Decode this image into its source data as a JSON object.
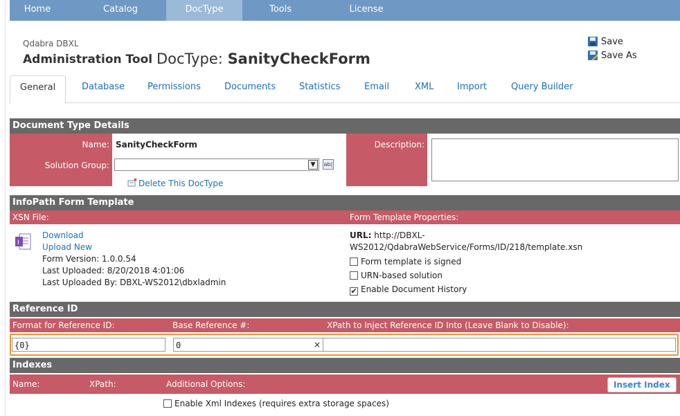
{
  "nav": [
    "Home",
    "Catalog",
    "DocType",
    "Tools",
    "License"
  ],
  "header": {
    "product": "Qdabra DBXL",
    "app_title": "Administration Tool",
    "doctype_prefix": "DocType:",
    "doctype_name": "SanityCheckForm",
    "save": "Save",
    "save_as": "Save As"
  },
  "tabs": [
    "General",
    "Database",
    "Permissions",
    "Documents",
    "Statistics",
    "Email",
    "XML",
    "Import",
    "Query Builder"
  ],
  "details": {
    "section_title": "Document Type Details",
    "name_label": "Name:",
    "name_value": "SanityCheckForm",
    "solution_group_label": "Solution Group:",
    "solution_group_value": "",
    "delete_label": "Delete This DocType",
    "description_label": "Description:",
    "description_value": ""
  },
  "infopath": {
    "section_title": "InfoPath Form Template",
    "xsn_label": "XSN File:",
    "props_label": "Form Template Properties:",
    "download": "Download",
    "upload": "Upload New",
    "version": "Form Version: 1.0.0.54",
    "last_uploaded": "Last Uploaded: 8/20/2018 4:01:06",
    "last_uploaded_by": "Last Uploaded By: DBXL-WS2012\\dbxladmin",
    "url_label": "URL:",
    "url_line1": "http://DBXL-",
    "url_line2": "WS2012/QdabraWebService/Forms/ID/218/template.xsn",
    "signed": "Form template is signed",
    "urn": "URN-based solution",
    "history": "Enable Document History",
    "signed_checked": false,
    "urn_checked": false,
    "history_checked": true
  },
  "reference": {
    "section_title": "Reference ID",
    "format_label": "Format for Reference ID:",
    "base_label": "Base Reference #:",
    "xpath_label": "XPath to Inject Reference ID Into (Leave Blank to Disable):",
    "format_value": "{0}",
    "base_value": "0",
    "xpath_value": "",
    "clear_glyph": "×"
  },
  "indexes": {
    "section_title": "Indexes",
    "name_col": "Name:",
    "xpath_col": "XPath:",
    "options_col": "Additional Options:",
    "insert_button": "Insert Index",
    "xml_indexes": "Enable Xml Indexes (requires extra storage spaces)",
    "xml_indexes_checked": false
  },
  "colors": {
    "nav_bg": "#6f99c4",
    "nav_active": "#9bb9d8",
    "section_dark": "#686868",
    "section_red": "#c65a66",
    "link": "#1d6fb8",
    "focus": "#f0922b"
  }
}
